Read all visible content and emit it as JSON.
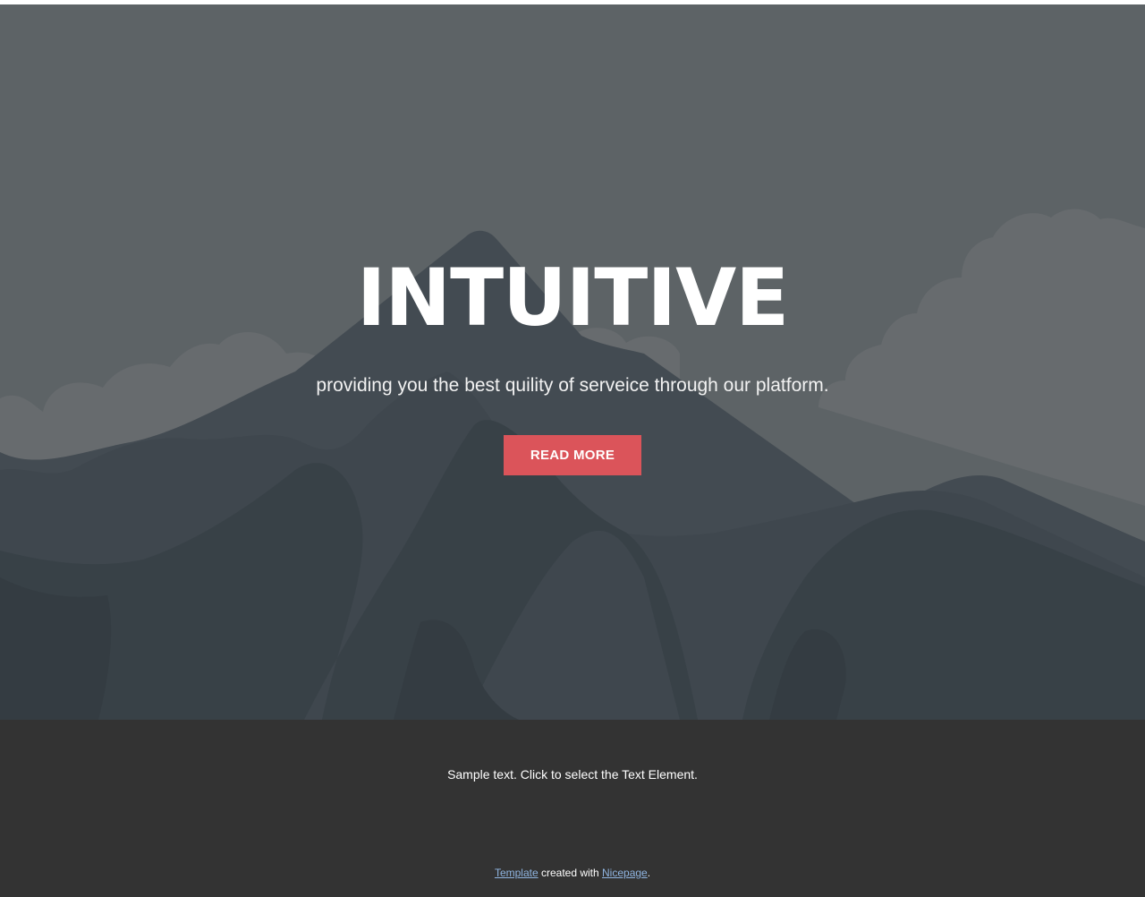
{
  "hero": {
    "title": "INTUITIVE",
    "subtitle": "providing you the best quility of serveice through our platform.",
    "button_label": "READ MORE",
    "background_color": "#5d6366",
    "button_color": "#db545a"
  },
  "footer": {
    "text": "Sample text. Click to select the Text Element.",
    "credit": {
      "template_link": "Template",
      "middle_text": " created with ",
      "nicepage_link": "Nicepage",
      "end_text": "."
    },
    "background_color": "#333333"
  }
}
